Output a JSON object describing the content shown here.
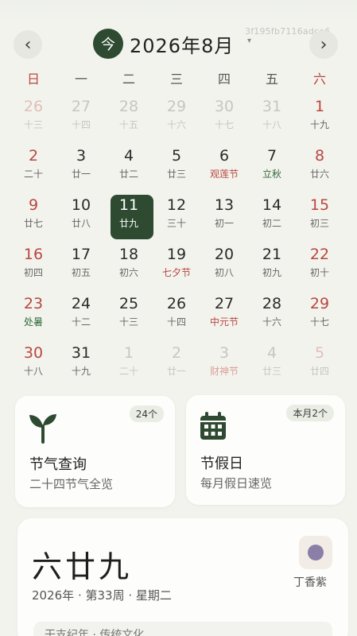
{
  "watermark": "3f195fb7116adce6",
  "header": {
    "prev_icon": "‹",
    "next_icon": "›",
    "today_label": "今",
    "month_title": "2026年8月",
    "caret": "▾"
  },
  "weekdays": [
    "日",
    "一",
    "二",
    "三",
    "四",
    "五",
    "六"
  ],
  "weeks": [
    [
      {
        "day": "26",
        "lunar": "十三",
        "outside": true
      },
      {
        "day": "27",
        "lunar": "十四",
        "outside": true
      },
      {
        "day": "28",
        "lunar": "十五",
        "outside": true
      },
      {
        "day": "29",
        "lunar": "十六",
        "outside": true
      },
      {
        "day": "30",
        "lunar": "十七",
        "outside": true
      },
      {
        "day": "31",
        "lunar": "十八",
        "outside": true
      },
      {
        "day": "1",
        "lunar": "十九"
      }
    ],
    [
      {
        "day": "2",
        "lunar": "二十"
      },
      {
        "day": "3",
        "lunar": "廿一"
      },
      {
        "day": "4",
        "lunar": "廿二"
      },
      {
        "day": "5",
        "lunar": "廿三"
      },
      {
        "day": "6",
        "lunar": "观莲节",
        "kind": "festival"
      },
      {
        "day": "7",
        "lunar": "立秋",
        "kind": "term"
      },
      {
        "day": "8",
        "lunar": "廿六"
      }
    ],
    [
      {
        "day": "9",
        "lunar": "廿七"
      },
      {
        "day": "10",
        "lunar": "廿八"
      },
      {
        "day": "11",
        "lunar": "廿九",
        "selected": true
      },
      {
        "day": "12",
        "lunar": "三十"
      },
      {
        "day": "13",
        "lunar": "初一"
      },
      {
        "day": "14",
        "lunar": "初二"
      },
      {
        "day": "15",
        "lunar": "初三"
      }
    ],
    [
      {
        "day": "16",
        "lunar": "初四"
      },
      {
        "day": "17",
        "lunar": "初五"
      },
      {
        "day": "18",
        "lunar": "初六"
      },
      {
        "day": "19",
        "lunar": "七夕节",
        "kind": "festival"
      },
      {
        "day": "20",
        "lunar": "初八"
      },
      {
        "day": "21",
        "lunar": "初九"
      },
      {
        "day": "22",
        "lunar": "初十"
      }
    ],
    [
      {
        "day": "23",
        "lunar": "处暑",
        "kind": "term"
      },
      {
        "day": "24",
        "lunar": "十二"
      },
      {
        "day": "25",
        "lunar": "十三"
      },
      {
        "day": "26",
        "lunar": "十四"
      },
      {
        "day": "27",
        "lunar": "中元节",
        "kind": "festival"
      },
      {
        "day": "28",
        "lunar": "十六"
      },
      {
        "day": "29",
        "lunar": "十七"
      }
    ],
    [
      {
        "day": "30",
        "lunar": "十八"
      },
      {
        "day": "31",
        "lunar": "十九"
      },
      {
        "day": "1",
        "lunar": "二十",
        "outside": true
      },
      {
        "day": "2",
        "lunar": "廿一",
        "outside": true
      },
      {
        "day": "3",
        "lunar": "财神节",
        "outside": true,
        "kind": "festival"
      },
      {
        "day": "4",
        "lunar": "廿三",
        "outside": true
      },
      {
        "day": "5",
        "lunar": "廿四",
        "outside": true
      }
    ]
  ],
  "solar_card": {
    "icon": "sprout-icon",
    "badge": "24个",
    "title": "节气查询",
    "subtitle": "二十四节气全览"
  },
  "holiday_card": {
    "icon": "calendar-icon",
    "badge": "本月2个",
    "title": "节假日",
    "subtitle": "每月假日速览"
  },
  "date_card": {
    "lunar_big": "六廿九",
    "date_line": "2026年 · 第33周 · 星期二",
    "color_name": "丁香紫",
    "color_hex": "#8b7fa8",
    "culture": "干支纪年 · 传统文化"
  },
  "colors": {
    "accent": "#2e4a31",
    "weekend": "#b8473f",
    "term": "#2f6a3b"
  }
}
